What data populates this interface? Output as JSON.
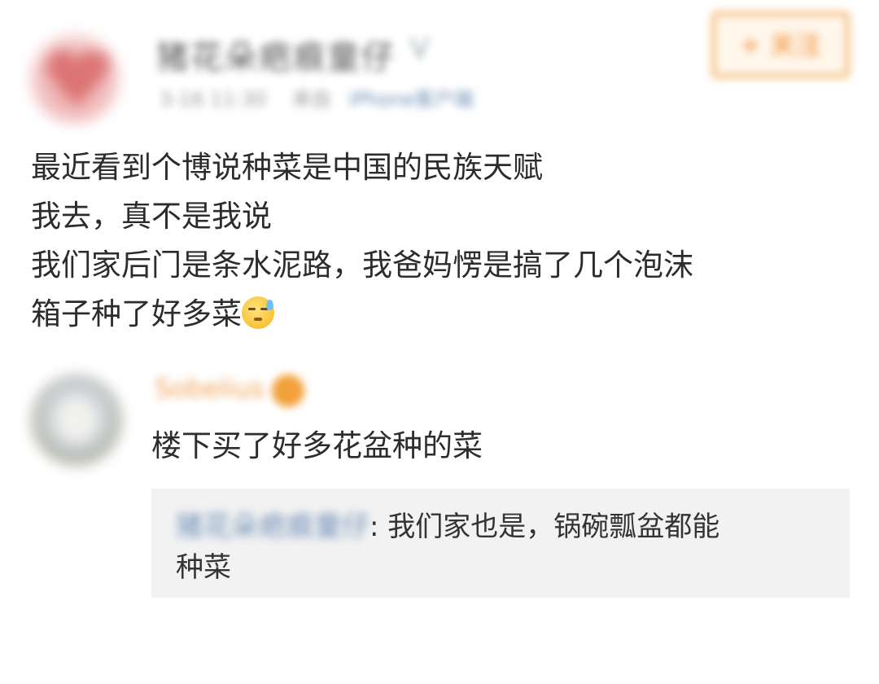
{
  "post": {
    "author_name": "猪花朵疤痕童仔",
    "verify_mark": "V",
    "time": "3-16 11:30",
    "source_prefix": "来自",
    "source": "iPhone客户端",
    "follow_label": "+ 关注",
    "lines": [
      "最近看到个博说种菜是中国的民族天赋",
      "我去，真不是我说",
      "我们家后门是条水泥路，我爸妈愣是搞了几个泡沫",
      "箱子种了好多菜"
    ]
  },
  "comment": {
    "author_name": "Sobelius",
    "text": "楼下买了好多花盆种的菜",
    "reply": {
      "author_name": "猪花朵疤痕童仔",
      "text": ": 我们家也是，锅碗瓢盆都能",
      "text_cont": "种菜"
    }
  },
  "icons": {
    "emoji": "sweat-smile-emoji",
    "badge": "member-badge-icon"
  },
  "colors": {
    "link": "#6f8fb8",
    "follow_accent": "#f08a2a",
    "commenter_name": "#f0a35a",
    "reply_background": "#f2f2f2"
  }
}
